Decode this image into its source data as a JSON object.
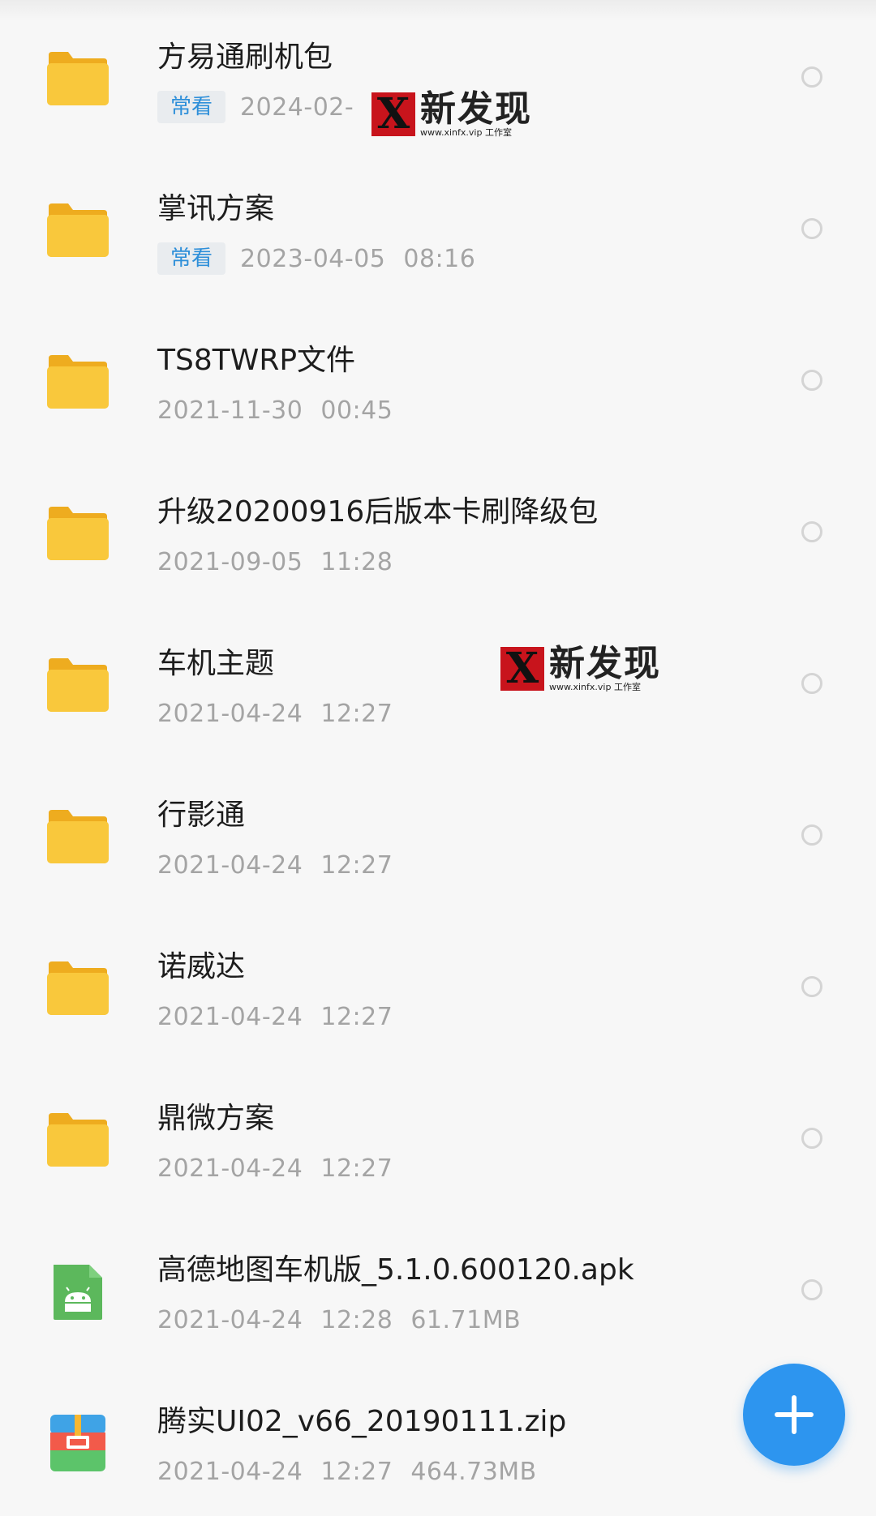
{
  "files": [
    {
      "name": "方易通刷机包",
      "badge": "常看",
      "date": "2024-02-",
      "time": "",
      "size": "",
      "type": "folder"
    },
    {
      "name": "掌讯方案",
      "badge": "常看",
      "date": "2023-04-05",
      "time": "08:16",
      "size": "",
      "type": "folder"
    },
    {
      "name": "TS8TWRP文件",
      "badge": "",
      "date": "2021-11-30",
      "time": "00:45",
      "size": "",
      "type": "folder"
    },
    {
      "name": "升级20200916后版本卡刷降级包",
      "badge": "",
      "date": "2021-09-05",
      "time": "11:28",
      "size": "",
      "type": "folder"
    },
    {
      "name": "车机主题",
      "badge": "",
      "date": "2021-04-24",
      "time": "12:27",
      "size": "",
      "type": "folder"
    },
    {
      "name": "行影通",
      "badge": "",
      "date": "2021-04-24",
      "time": "12:27",
      "size": "",
      "type": "folder"
    },
    {
      "name": "诺威达",
      "badge": "",
      "date": "2021-04-24",
      "time": "12:27",
      "size": "",
      "type": "folder"
    },
    {
      "name": "鼎微方案",
      "badge": "",
      "date": "2021-04-24",
      "time": "12:27",
      "size": "",
      "type": "folder"
    },
    {
      "name": "高德地图车机版_5.1.0.600120.apk",
      "badge": "",
      "date": "2021-04-24",
      "time": "12:28",
      "size": "61.71MB",
      "type": "apk"
    },
    {
      "name": "腾实UI02_v66_20190111.zip",
      "badge": "",
      "date": "2021-04-24",
      "time": "12:27",
      "size": "464.73MB",
      "type": "zip"
    }
  ],
  "watermark": {
    "letter": "X",
    "text": "新发现",
    "url": "www.xinfx.vip 工作室"
  },
  "fab_icon": "plus-icon",
  "colors": {
    "accent": "#2d95ef",
    "folder": "#f8c53a",
    "apk": "#5cb85c",
    "badge_text": "#2e8fd9"
  }
}
